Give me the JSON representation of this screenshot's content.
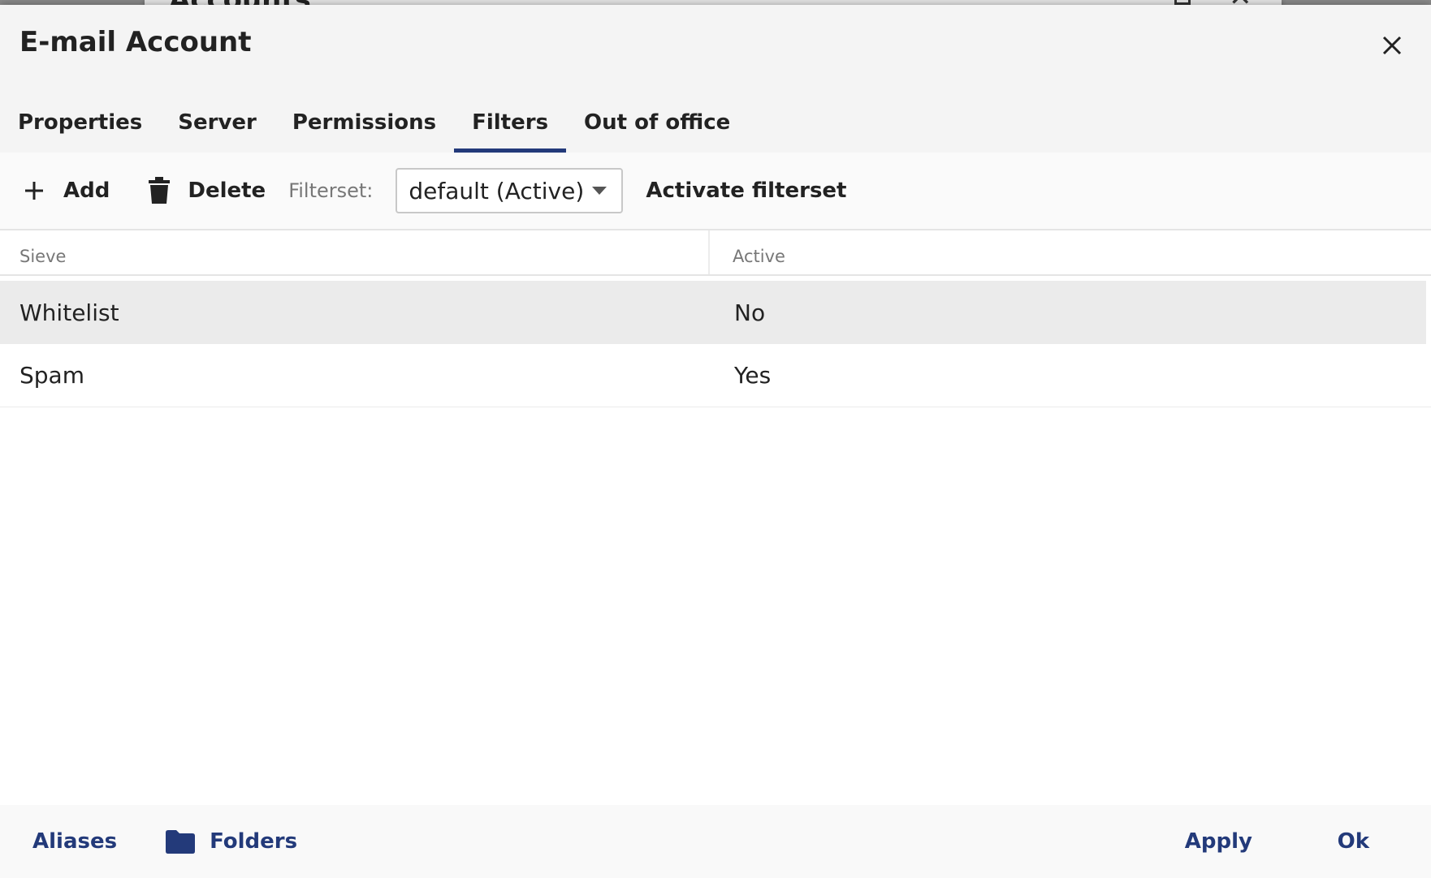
{
  "background_window": {
    "title": "Accounts"
  },
  "dialog": {
    "title": "E-mail Account",
    "close_icon": "close-icon"
  },
  "tabs": [
    {
      "label": "Properties",
      "active": false
    },
    {
      "label": "Server",
      "active": false
    },
    {
      "label": "Permissions",
      "active": false
    },
    {
      "label": "Filters",
      "active": true
    },
    {
      "label": "Out of office",
      "active": false
    }
  ],
  "toolbar": {
    "add_label": "Add",
    "add_icon": "plus-icon",
    "delete_label": "Delete",
    "delete_icon": "trash-icon",
    "filterset_label": "Filterset:",
    "filterset_value": "default (Active)",
    "activate_label": "Activate filterset"
  },
  "table": {
    "columns": [
      "Sieve",
      "Active"
    ],
    "rows": [
      {
        "sieve": "Whitelist",
        "active": "No",
        "selected": true
      },
      {
        "sieve": "Spam",
        "active": "Yes",
        "selected": false
      }
    ]
  },
  "footer": {
    "aliases_label": "Aliases",
    "folders_label": "Folders",
    "folders_icon": "folder-icon",
    "apply_label": "Apply",
    "ok_label": "Ok"
  },
  "colors": {
    "accent": "#233a7a",
    "selected_row": "#ebebeb",
    "header_bg": "#f4f4f4"
  }
}
